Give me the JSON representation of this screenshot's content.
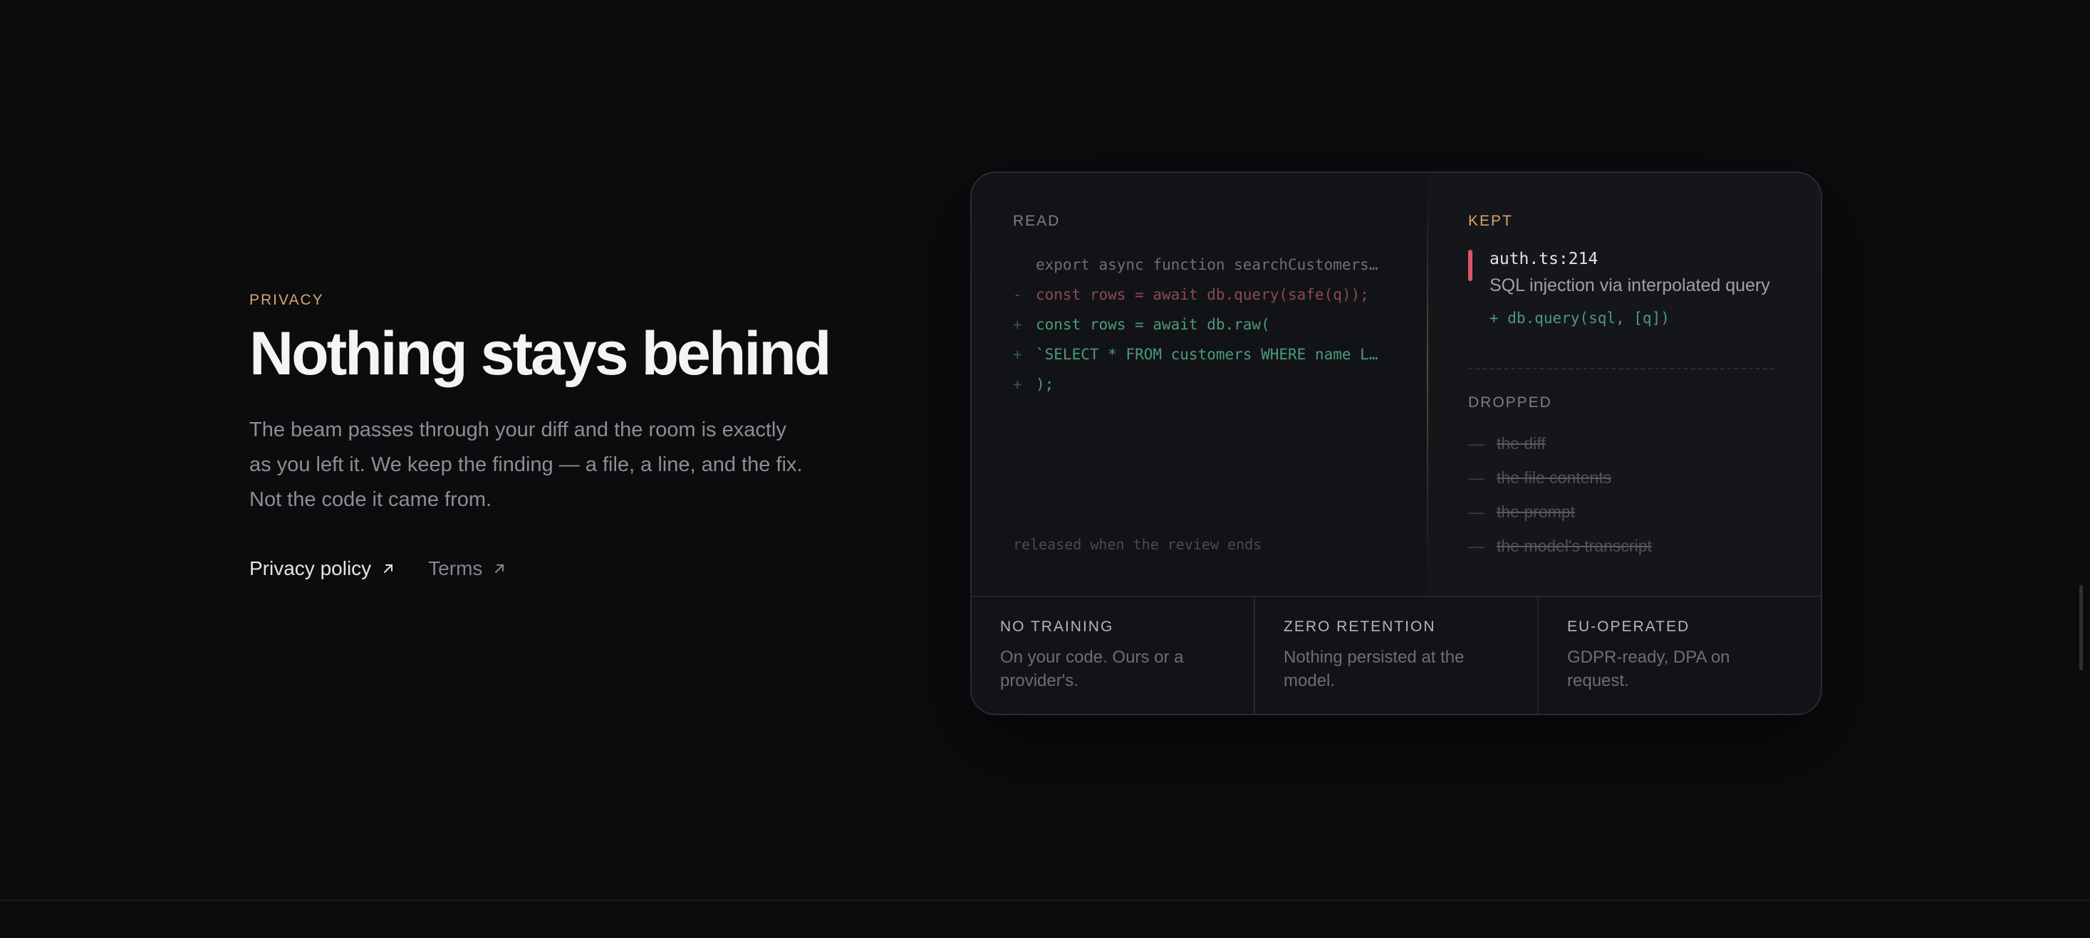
{
  "hero": {
    "eyebrow": "PRIVACY",
    "title": "Nothing stays behind",
    "body": "The beam passes through your diff and the room is exactly as you left it. We keep the finding — a file, a line, and the fix. Not the code it came from.",
    "links": [
      {
        "label": "Privacy policy",
        "icon": "arrow-up-right-icon"
      },
      {
        "label": "Terms",
        "icon": "arrow-up-right-icon"
      }
    ]
  },
  "card": {
    "read": {
      "label": "READ",
      "lines": [
        {
          "sign": "",
          "text": "export async function searchCustomers…"
        },
        {
          "sign": "-",
          "text": "const rows = await db.query(safe(q));"
        },
        {
          "sign": "+",
          "text": "const rows = await db.raw("
        },
        {
          "sign": "+",
          "text": "`SELECT * FROM customers WHERE name L…"
        },
        {
          "sign": "+",
          "text": ");"
        }
      ],
      "footnote": "released when the review ends"
    },
    "kept": {
      "label": "KEPT",
      "file": "auth.ts:214",
      "description": "SQL injection via interpolated query",
      "fix": "+ db.query(sql, [q])"
    },
    "dropped": {
      "label": "DROPPED",
      "dash": "—",
      "items": [
        "the diff",
        "the file contents",
        "the prompt",
        "the model's transcript"
      ]
    },
    "features": [
      {
        "title": "NO TRAINING",
        "desc": "On your code. Ours or a provider's."
      },
      {
        "title": "ZERO RETENTION",
        "desc": "Nothing persisted at the model."
      },
      {
        "title": "EU-OPERATED",
        "desc": "GDPR-ready, DPA on request."
      }
    ]
  },
  "colors": {
    "accent": "#d9a46a",
    "removed": "#8a4a56",
    "added": "#4a9b7a",
    "finding_marker": "#d9566c",
    "background": "#0b0c0e"
  }
}
